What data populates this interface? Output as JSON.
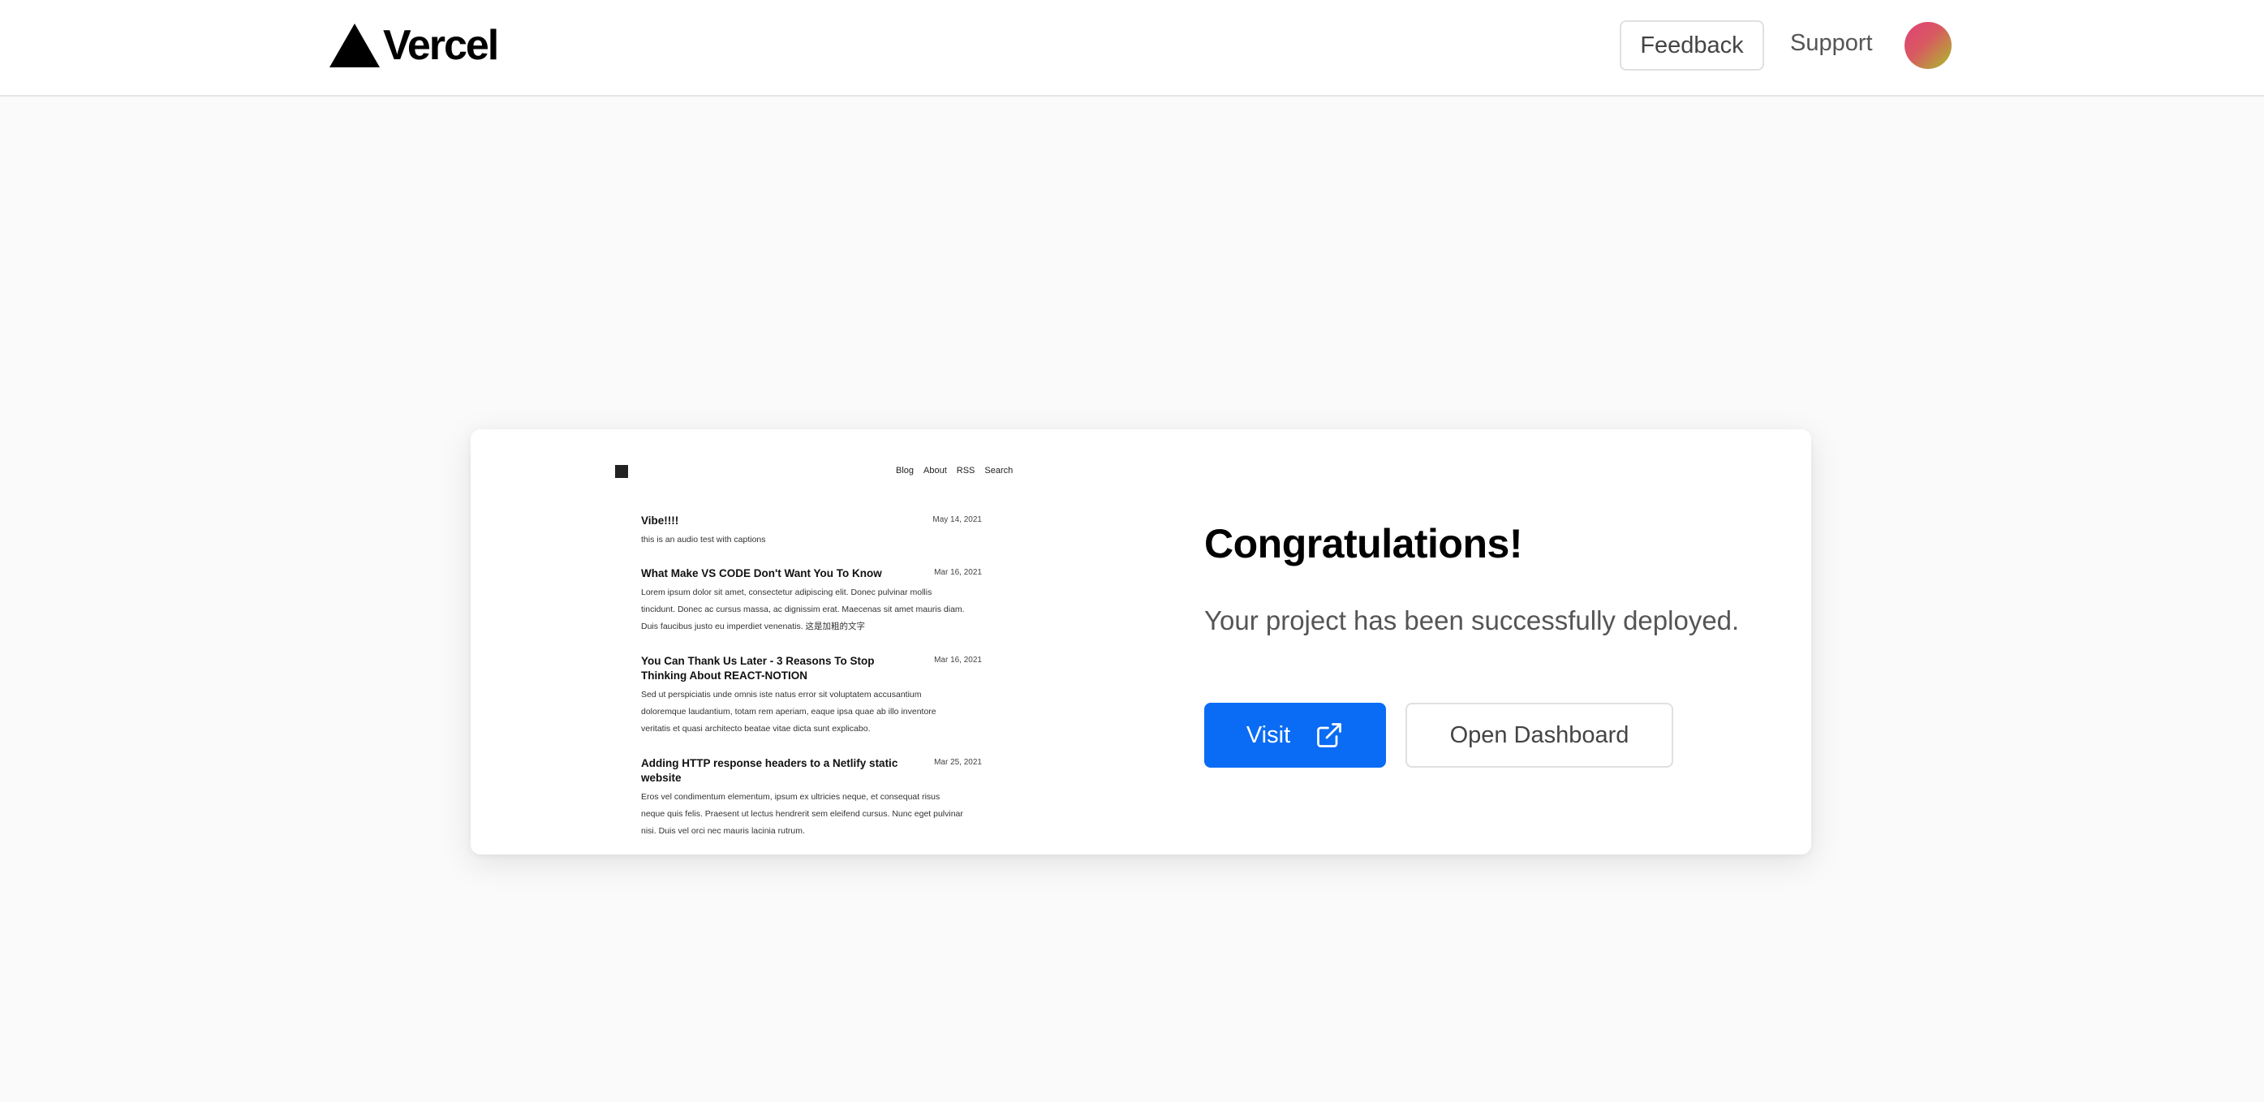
{
  "header": {
    "logo_text": "Vercel",
    "feedback_label": "Feedback",
    "support_label": "Support"
  },
  "preview": {
    "nav": [
      "Blog",
      "About",
      "RSS",
      "Search"
    ],
    "posts": [
      {
        "title": "Vibe!!!!",
        "date": "May 14, 2021",
        "excerpt": "this is an audio test with captions"
      },
      {
        "title": "What Make VS CODE Don't Want You To Know",
        "date": "Mar 16, 2021",
        "excerpt": "Lorem ipsum dolor sit amet, consectetur adipiscing elit. Donec pulvinar mollis tincidunt. Donec ac cursus massa, ac dignissim erat. Maecenas sit amet mauris diam. Duis faucibus justo eu imperdiet venenatis. 这是加粗的文字"
      },
      {
        "title": "You Can Thank Us Later - 3 Reasons To Stop Thinking About REACT-NOTION",
        "date": "Mar 16, 2021",
        "excerpt": "Sed ut perspiciatis unde omnis iste natus error sit voluptatem accusantium doloremque laudantium, totam rem aperiam, eaque ipsa quae ab illo inventore veritatis et quasi architecto beatae vitae dicta sunt explicabo."
      },
      {
        "title": "Adding HTTP response headers to a Netlify static website",
        "date": "Mar 25, 2021",
        "excerpt": "Eros vel condimentum elementum, ipsum ex ultricies neque, et consequat risus neque quis felis. Praesent ut lectus hendrerit sem eleifend cursus. Nunc eget pulvinar nisi. Duis vel orci nec mauris lacinia rutrum."
      }
    ]
  },
  "main": {
    "title": "Congratulations!",
    "subtitle": "Your project has been successfully deployed.",
    "visit_label": "Visit",
    "dashboard_label": "Open Dashboard"
  },
  "colors": {
    "accent": "#0a6cf5",
    "background": "#fafafa"
  },
  "icons": {
    "visit": "external-link-icon"
  }
}
